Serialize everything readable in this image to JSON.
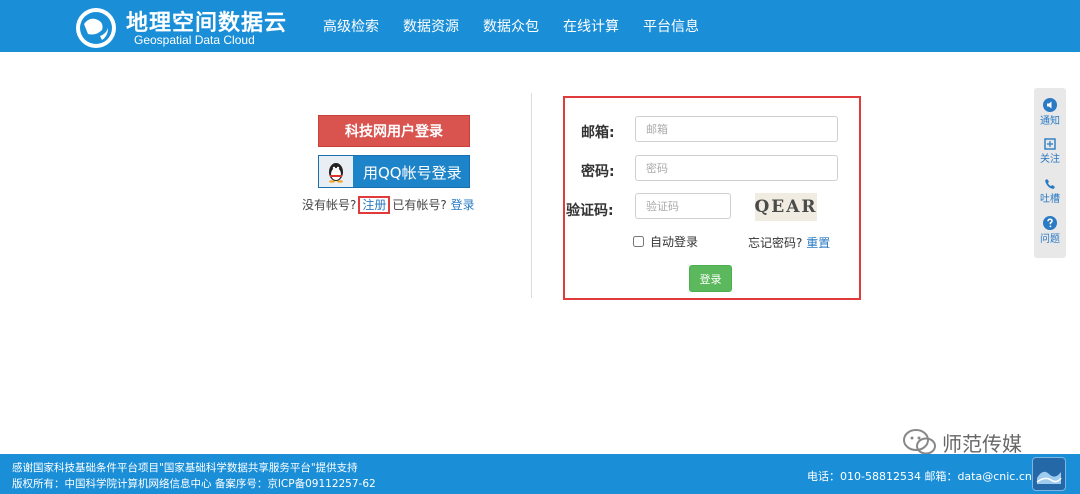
{
  "header": {
    "logo_cn": "地理空间数据云",
    "logo_en": "Geospatial Data Cloud",
    "nav": [
      {
        "label": "高级检索"
      },
      {
        "label": "数据资源"
      },
      {
        "label": "数据众包"
      },
      {
        "label": "在线计算"
      },
      {
        "label": "平台信息"
      }
    ]
  },
  "left_panel": {
    "kjw_button": "科技网用户登录",
    "qq_button": "用QQ帐号登录",
    "no_account": "没有帐号?",
    "register": "注册",
    "have_account": "已有帐号?",
    "login_link": "登录"
  },
  "form": {
    "email_label": "邮箱:",
    "email_placeholder": "邮箱",
    "password_label": "密码:",
    "password_placeholder": "密码",
    "captcha_label": "验证码:",
    "captcha_placeholder": "验证码",
    "captcha_text": "QEAR",
    "remember": "自动登录",
    "forgot": "忘记密码?",
    "reset": "重置",
    "submit": "登录"
  },
  "side_panel": {
    "items": [
      {
        "label": "通知",
        "icon": "speaker-icon"
      },
      {
        "label": "关注",
        "icon": "follow-icon"
      },
      {
        "label": "吐槽",
        "icon": "phone-icon"
      },
      {
        "label": "问题",
        "icon": "question-icon"
      }
    ]
  },
  "watermark": {
    "text": "师范传媒"
  },
  "footer": {
    "line1": "感谢国家科技基础条件平台项目\"国家基础科学数据共享服务平台\"提供支持",
    "line2": "版权所有：中国科学院计算机网络信息中心 备案序号：京ICP备09112257-62",
    "contact": "电话：010-58812534   邮箱：data@cnic.cn"
  },
  "colors": {
    "header_bg": "#1a8fd8",
    "red_button": "#d9534f",
    "qq_button": "#1e84c9",
    "login_button": "#5cb85c",
    "highlight_border": "#e03a3a"
  }
}
